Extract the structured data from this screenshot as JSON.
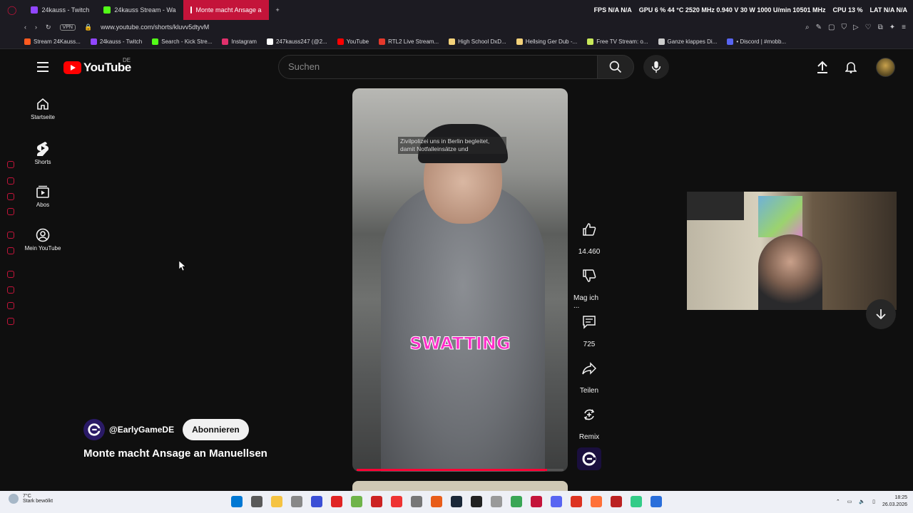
{
  "browser": {
    "tabs": [
      {
        "label": "24kauss - Twitch",
        "color": "#9146ff"
      },
      {
        "label": "24kauss Stream - Wa",
        "color": "#53fc18"
      },
      {
        "label": "Monte macht Ansage a",
        "color": "#ff0000"
      }
    ],
    "stats": [
      "FPS N/A N/A",
      "GPU 6 % 44 °C 2520 MHz 0.940 V 30 W 1000 U/min 10501 MHz",
      "CPU 13 %",
      "LAT N/A N/A"
    ],
    "url": "www.youtube.com/shorts/kluvv5dtyvM",
    "vpn": "VPN",
    "bookmarks": [
      {
        "label": "Stream 24Kauss...",
        "color": "#ff5a1f"
      },
      {
        "label": "24kauss - Twitch",
        "color": "#9146ff"
      },
      {
        "label": "Search - Kick Stre...",
        "color": "#53fc18"
      },
      {
        "label": "Instagram",
        "color": "#e1306c"
      },
      {
        "label": "247kauss247 (@2...",
        "color": "#ffffff"
      },
      {
        "label": "YouTube",
        "color": "#ff0000"
      },
      {
        "label": "RTL2 Live Stream...",
        "color": "#e5382b"
      },
      {
        "label": "High School DxD...",
        "color": "#f3d27a"
      },
      {
        "label": "Hellsing Ger Dub -...",
        "color": "#f3d27a"
      },
      {
        "label": "Free TV Stream: o...",
        "color": "#c8e85a"
      },
      {
        "label": "Ganze klappes Di...",
        "color": "#cccccc"
      },
      {
        "label": "• Discord | #mobb...",
        "color": "#5865f2"
      }
    ]
  },
  "youtube": {
    "logo_text": "YouTube",
    "region": "DE",
    "search_placeholder": "Suchen",
    "nav": [
      {
        "label": "Startseite",
        "icon": "home-icon"
      },
      {
        "label": "Shorts",
        "icon": "shorts-icon"
      },
      {
        "label": "Abos",
        "icon": "subscriptions-icon"
      },
      {
        "label": "Mein YouTube",
        "icon": "account-icon"
      }
    ],
    "short": {
      "caption_top": "Zivilpolizei uns in Berlin begleitet, damit Notfalleinsätze und",
      "overlay_word": "SWATTING",
      "progress": 0.92,
      "channel": "@EarlyGameDE",
      "subscribe": "Abonnieren",
      "title": "Monte macht Ansage an Manuellsen"
    },
    "actions": {
      "likes": "14.460",
      "dislike": "Mag ich ...",
      "comments": "725",
      "share": "Teilen",
      "remix": "Remix"
    }
  },
  "taskbar": {
    "weather_temp": "7°C",
    "weather_desc": "Stark bewölkt",
    "time": "18:25",
    "date": "26.03.2026"
  }
}
